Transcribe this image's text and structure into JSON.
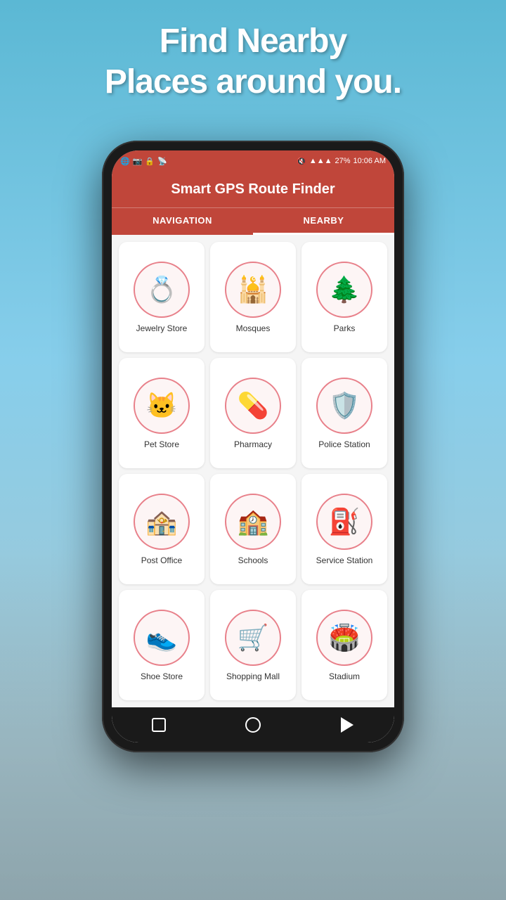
{
  "page": {
    "headline_line1": "Find Nearby",
    "headline_line2": "Places around you."
  },
  "app": {
    "title": "Smart GPS Route Finder",
    "tabs": [
      {
        "id": "navigation",
        "label": "NAVIGATION",
        "active": false
      },
      {
        "id": "nearby",
        "label": "NEARBY",
        "active": true
      }
    ],
    "status_bar": {
      "time": "10:06 AM",
      "battery": "27%",
      "signal": "●●●●"
    }
  },
  "grid_items": [
    {
      "id": "jewelry-store",
      "label": "Jewelry Store",
      "emoji": "💍"
    },
    {
      "id": "mosques",
      "label": "Mosques",
      "emoji": "🕌"
    },
    {
      "id": "parks",
      "label": "Parks",
      "emoji": "🌲"
    },
    {
      "id": "pet-store",
      "label": "Pet Store",
      "emoji": "🐱"
    },
    {
      "id": "pharmacy",
      "label": "Pharmacy",
      "emoji": "💊"
    },
    {
      "id": "police-station",
      "label": "Police Station",
      "emoji": "🛡️"
    },
    {
      "id": "post-office",
      "label": "Post Office",
      "emoji": "🏤"
    },
    {
      "id": "schools",
      "label": "Schools",
      "emoji": "🏫"
    },
    {
      "id": "service-station",
      "label": "Service Station",
      "emoji": "⛽"
    },
    {
      "id": "shoe-store",
      "label": "Shoe Store",
      "emoji": "👟"
    },
    {
      "id": "shopping-mall",
      "label": "Shopping Mall",
      "emoji": "🛒"
    },
    {
      "id": "stadium",
      "label": "Stadium",
      "emoji": "🏟️"
    }
  ]
}
